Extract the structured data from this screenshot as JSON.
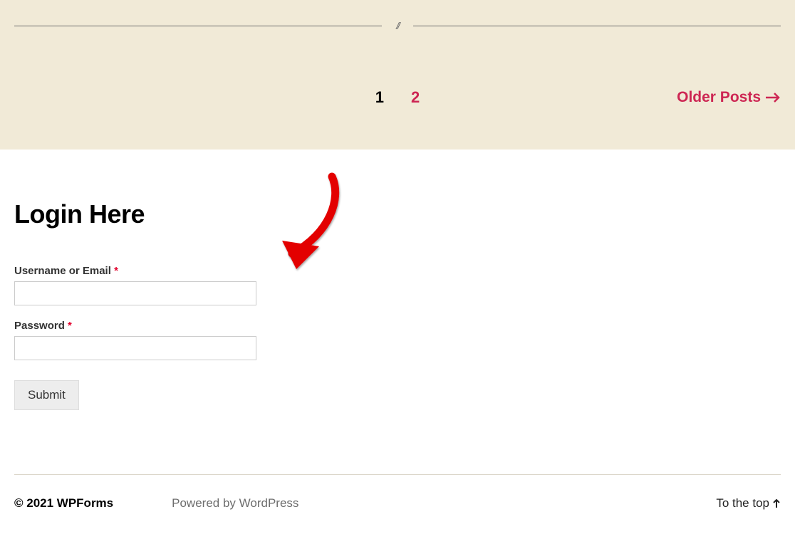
{
  "divider": {
    "slashes": "//"
  },
  "pagination": {
    "current": "1",
    "next": "2",
    "older_label": "Older Posts"
  },
  "login": {
    "heading": "Login Here",
    "username_label": "Username or Email",
    "password_label": "Password",
    "required": "*",
    "submit": "Submit"
  },
  "footer": {
    "copyright": "© 2021 WPForms",
    "powered": "Powered by WordPress",
    "to_top": "To the top"
  }
}
